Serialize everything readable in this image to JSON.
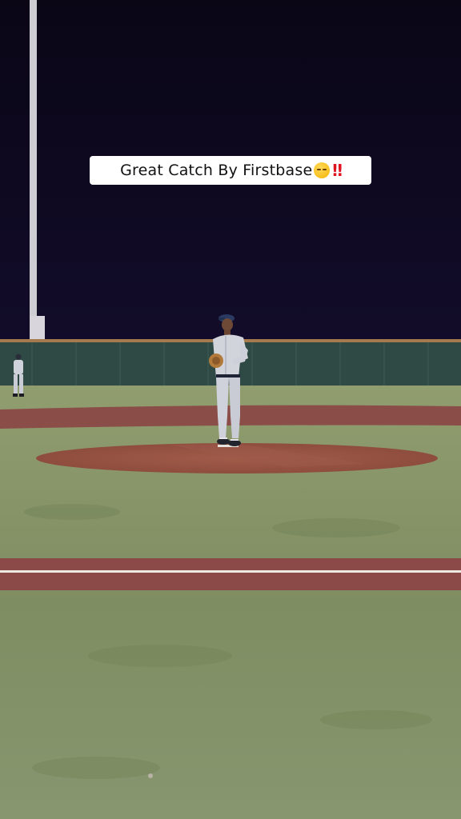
{
  "caption": {
    "text": "Great Catch By Firstbase",
    "emoji": "😮‍💨‼️",
    "emoji_face_icon": "relieved-face-icon",
    "emoji_bang_icon": "double-exclamation-icon",
    "bang_text": "‼"
  },
  "scene": {
    "sky_color": "#0b0719",
    "wall_color": "#2f4a45",
    "grass_color": "#8a9a6e",
    "dirt_color": "#8b4a44",
    "mound_color": "#9a5744",
    "chalk_color": "#e8e4e0"
  }
}
